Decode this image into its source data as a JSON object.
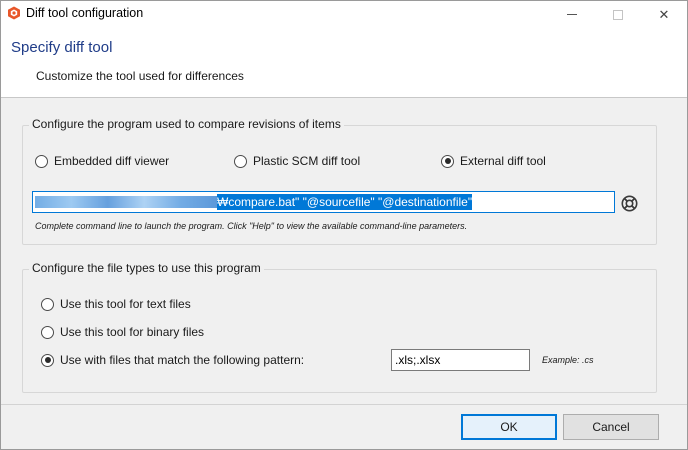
{
  "window": {
    "title": "Diff tool configuration",
    "close_glyph": "✕"
  },
  "header": {
    "title": "Specify diff tool",
    "subtitle": "Customize the tool used for differences"
  },
  "compare_group": {
    "label": "Configure the program used to compare revisions of items",
    "options": [
      {
        "label": "Embedded diff viewer",
        "checked": false
      },
      {
        "label": "Plastic SCM diff tool",
        "checked": false
      },
      {
        "label": "External diff tool",
        "checked": true
      }
    ],
    "command_line_value": "₩compare.bat\" \"@sourcefile\" \"@destinationfile\"",
    "hint": "Complete command line to launch the program. Click \"Help\" to view the available command-line parameters."
  },
  "filetype_group": {
    "label": "Configure the file types to use this program",
    "options": [
      {
        "label": "Use this tool for text files",
        "checked": false
      },
      {
        "label": "Use this tool for binary files",
        "checked": false
      },
      {
        "label": "Use with files that match the following pattern:",
        "checked": true
      }
    ],
    "pattern_value": ".xls;.xlsx",
    "example": "Example: .cs"
  },
  "footer": {
    "ok_label": "OK",
    "cancel_label": "Cancel"
  },
  "icons": {
    "app": "plastic-scm-app-icon",
    "help": "lifebuoy-help-icon"
  },
  "colors": {
    "accent": "#0078d7",
    "header_title": "#1f3c88",
    "app_icon": "#e8572a"
  }
}
